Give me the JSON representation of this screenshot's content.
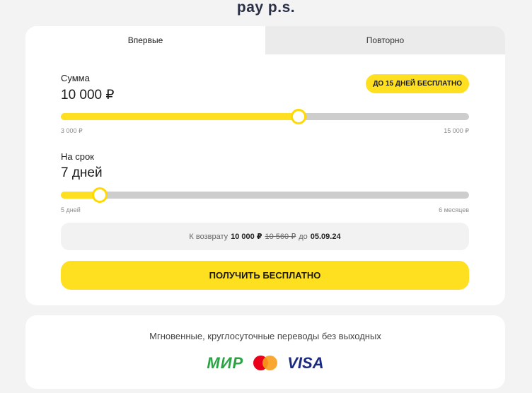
{
  "logo": {
    "text": "pay p.s."
  },
  "tabs": [
    {
      "label": "Впервые",
      "active": true
    },
    {
      "label": "Повторно",
      "active": false
    }
  ],
  "amount": {
    "label": "Сумма",
    "value": "10 000 ₽",
    "badge": "ДО 15 ДНЕЙ БЕСПЛАТНО",
    "min": "3 000 ₽",
    "max": "15 000 ₽",
    "slider_fraction": 0.583
  },
  "term": {
    "label": "На срок",
    "value": "7 дней",
    "min": "5 дней",
    "max": "6 месяцев",
    "slider_fraction": 0.095
  },
  "summary": {
    "prefix": "К возврату",
    "amount": "10 000 ₽",
    "old_amount": "10 560 ₽",
    "middle": "до",
    "date": "05.09.24"
  },
  "cta": {
    "label": "ПОЛУЧИТЬ БЕСПЛАТНО"
  },
  "info": {
    "text": "Мгновенные, круглосуточные переводы без выходных",
    "payment_logos": [
      {
        "name": "МИР",
        "text": "МИР",
        "color": "#2aa345"
      },
      {
        "name": "mastercard",
        "colors": [
          "#eb001b",
          "#f79e1b"
        ]
      },
      {
        "name": "VISA",
        "text": "VISA",
        "color": "#1a2a80"
      }
    ]
  },
  "colors": {
    "accent": "#ffe021",
    "track": "#cdcdcd",
    "background": "#f3f3f3"
  }
}
